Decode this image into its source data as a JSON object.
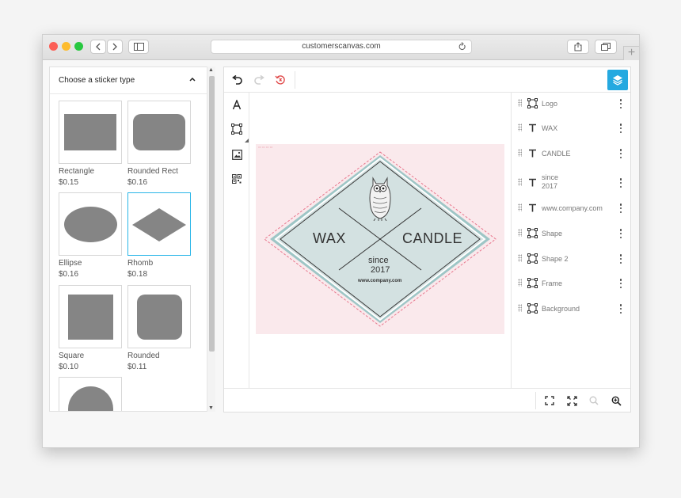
{
  "browser": {
    "url": "customerscanvas.com"
  },
  "sticker_panel": {
    "title": "Choose a sticker type",
    "items": [
      {
        "name": "Rectangle",
        "price": "$0.15",
        "shape": "rectangle",
        "selected": false
      },
      {
        "name": "Rounded Rect",
        "price": "$0.16",
        "shape": "rounded-rect",
        "selected": false
      },
      {
        "name": "Ellipse",
        "price": "$0.16",
        "shape": "ellipse",
        "selected": false
      },
      {
        "name": "Rhomb",
        "price": "$0.18",
        "shape": "rhomb",
        "selected": true
      },
      {
        "name": "Square",
        "price": "$0.10",
        "shape": "square",
        "selected": false
      },
      {
        "name": "Rounded",
        "price": "$0.11",
        "shape": "rounded",
        "selected": false
      },
      {
        "name": "",
        "price": "",
        "shape": "circle",
        "selected": false
      }
    ]
  },
  "design": {
    "left_text": "WAX",
    "right_text": "CANDLE",
    "since": "since",
    "year": "2017",
    "website": "www.company.com"
  },
  "layers": [
    {
      "name": "Logo",
      "type": "image"
    },
    {
      "name": "WAX",
      "type": "text"
    },
    {
      "name": "CANDLE",
      "type": "text"
    },
    {
      "name": "since\n2017",
      "type": "text"
    },
    {
      "name": "www.company.com",
      "type": "text"
    },
    {
      "name": "Shape",
      "type": "image"
    },
    {
      "name": "Shape 2",
      "type": "image"
    },
    {
      "name": "Frame",
      "type": "image"
    },
    {
      "name": "Background",
      "type": "image"
    }
  ],
  "colors": {
    "accent": "#25a9e0",
    "selected_border": "#29b6e8",
    "canvas_bg": "#fae9ec",
    "rhomb_fill": "#d3e1e1",
    "rhomb_outline": "#9ec6c6",
    "cut_line": "#e8788e",
    "shape_gray": "#858585"
  }
}
